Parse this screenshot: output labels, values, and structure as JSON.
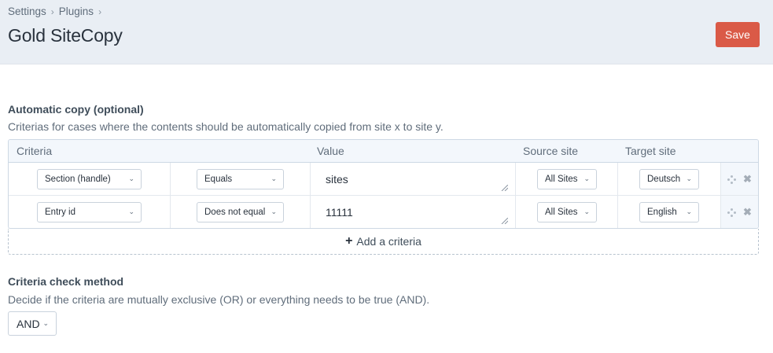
{
  "breadcrumb": {
    "items": [
      "Settings",
      "Plugins"
    ]
  },
  "page": {
    "title": "Gold SiteCopy",
    "save_label": "Save"
  },
  "automatic_copy": {
    "heading": "Automatic copy (optional)",
    "instructions": "Criterias for cases where the contents should be automatically copied from site x to site y.",
    "columns": [
      "Criteria",
      "Value",
      "Source site",
      "Target site"
    ],
    "rows": [
      {
        "field": "Section (handle)",
        "operator": "Equals",
        "value": "sites",
        "source": "All Sites",
        "target": "Deutsch"
      },
      {
        "field": "Entry id",
        "operator": "Does not equal",
        "value": "11111",
        "source": "All Sites",
        "target": "English"
      }
    ],
    "add_label": "Add a criteria"
  },
  "check_method": {
    "heading": "Criteria check method",
    "instructions": "Decide if the criteria are mutually exclusive (OR) or everything needs to be true (AND).",
    "selected": "AND"
  },
  "icons": {
    "separator": "chevron-right-icon",
    "dropdown": "chevron-down-icon",
    "move": "move-icon",
    "delete": "delete-icon",
    "add": "plus-icon",
    "resize": "resize-grip-icon"
  },
  "colors": {
    "header_bg": "#e9eef4",
    "save_button": "#da5a47",
    "table_header_bg": "#f3f7fc"
  }
}
